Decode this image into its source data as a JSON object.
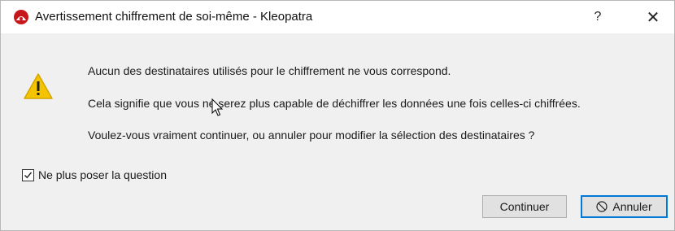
{
  "window": {
    "title": "Avertissement chiffrement de soi-même - Kleopatra",
    "help_label": "?",
    "close_label": "✕"
  },
  "icons": {
    "app": "kleopatra-app-icon",
    "warning": "warning-icon",
    "cancel": "no-entry-icon",
    "cursor": "mouse-cursor-icon"
  },
  "colors": {
    "warning_yellow": "#f5c400",
    "default_button_border": "#0078d7",
    "app_icon_red": "#c8171b"
  },
  "message": {
    "line1": "Aucun des destinataires utilisés pour le chiffrement ne vous correspond.",
    "line2": "Cela signifie que vous ne serez plus capable de déchiffrer les données une fois celles-ci chiffrées.",
    "line3": "Voulez-vous vraiment continuer, ou annuler pour modifier la sélection des destinataires ?"
  },
  "checkbox": {
    "label": "Ne plus poser la question",
    "checked": true
  },
  "buttons": {
    "continue_label": "Continuer",
    "cancel_label": "Annuler"
  }
}
